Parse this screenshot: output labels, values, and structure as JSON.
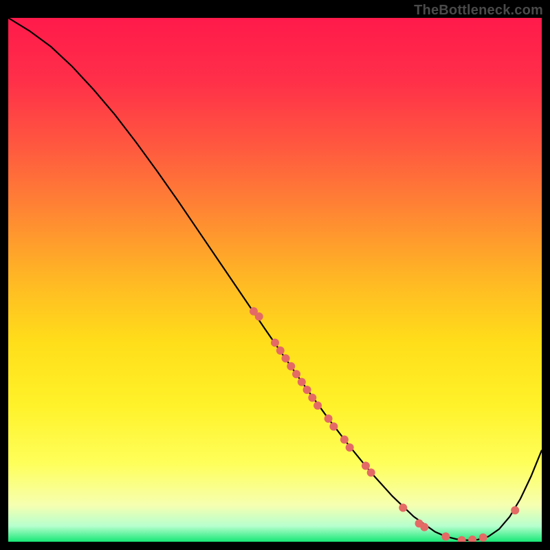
{
  "watermark": "TheBottleneck.com",
  "chart_data": {
    "type": "line",
    "title": "",
    "xlabel": "",
    "ylabel": "",
    "xlim": [
      0,
      100
    ],
    "ylim": [
      0,
      100
    ],
    "curve": {
      "x": [
        0,
        4,
        8,
        12,
        16,
        20,
        24,
        28,
        32,
        36,
        40,
        44,
        48,
        52,
        56,
        60,
        64,
        68,
        72,
        76,
        80,
        82,
        84,
        86,
        88,
        90,
        92,
        94,
        96,
        98,
        100
      ],
      "y": [
        100,
        97.5,
        94.5,
        90.7,
        86.3,
        81.5,
        76.2,
        70.6,
        64.8,
        58.8,
        52.8,
        46.8,
        40.8,
        34.9,
        29.1,
        23.5,
        18.2,
        13.2,
        8.7,
        4.8,
        1.9,
        1.0,
        0.5,
        0.3,
        0.4,
        1.0,
        2.4,
        4.8,
        8.2,
        12.5,
        17.5
      ]
    },
    "points": [
      {
        "x": 46,
        "y": 44.0
      },
      {
        "x": 47,
        "y": 43.0
      },
      {
        "x": 50,
        "y": 38.0
      },
      {
        "x": 51,
        "y": 36.5
      },
      {
        "x": 52,
        "y": 35.0
      },
      {
        "x": 53,
        "y": 33.5
      },
      {
        "x": 54,
        "y": 32.0
      },
      {
        "x": 55,
        "y": 30.5
      },
      {
        "x": 56,
        "y": 29.0
      },
      {
        "x": 57,
        "y": 27.5
      },
      {
        "x": 58,
        "y": 26.0
      },
      {
        "x": 60,
        "y": 23.5
      },
      {
        "x": 61,
        "y": 22.0
      },
      {
        "x": 63,
        "y": 19.5
      },
      {
        "x": 64,
        "y": 18.0
      },
      {
        "x": 67,
        "y": 14.5
      },
      {
        "x": 68,
        "y": 13.2
      },
      {
        "x": 74,
        "y": 6.5
      },
      {
        "x": 77,
        "y": 3.5
      },
      {
        "x": 78,
        "y": 2.8
      },
      {
        "x": 82,
        "y": 1.0
      },
      {
        "x": 85,
        "y": 0.3
      },
      {
        "x": 87,
        "y": 0.4
      },
      {
        "x": 89,
        "y": 0.8
      },
      {
        "x": 95,
        "y": 6.0
      }
    ],
    "background_gradient": {
      "stops": [
        {
          "offset": 0.0,
          "color": "#ff1a4b"
        },
        {
          "offset": 0.12,
          "color": "#ff2f49"
        },
        {
          "offset": 0.25,
          "color": "#ff5a3f"
        },
        {
          "offset": 0.38,
          "color": "#ff8a32"
        },
        {
          "offset": 0.5,
          "color": "#ffb824"
        },
        {
          "offset": 0.62,
          "color": "#ffde1a"
        },
        {
          "offset": 0.74,
          "color": "#fff22a"
        },
        {
          "offset": 0.85,
          "color": "#ffff5a"
        },
        {
          "offset": 0.93,
          "color": "#f6ffb0"
        },
        {
          "offset": 0.97,
          "color": "#b6ffce"
        },
        {
          "offset": 1.0,
          "color": "#17e876"
        }
      ]
    },
    "point_color": "#e46a65",
    "line_color": "#000000"
  }
}
